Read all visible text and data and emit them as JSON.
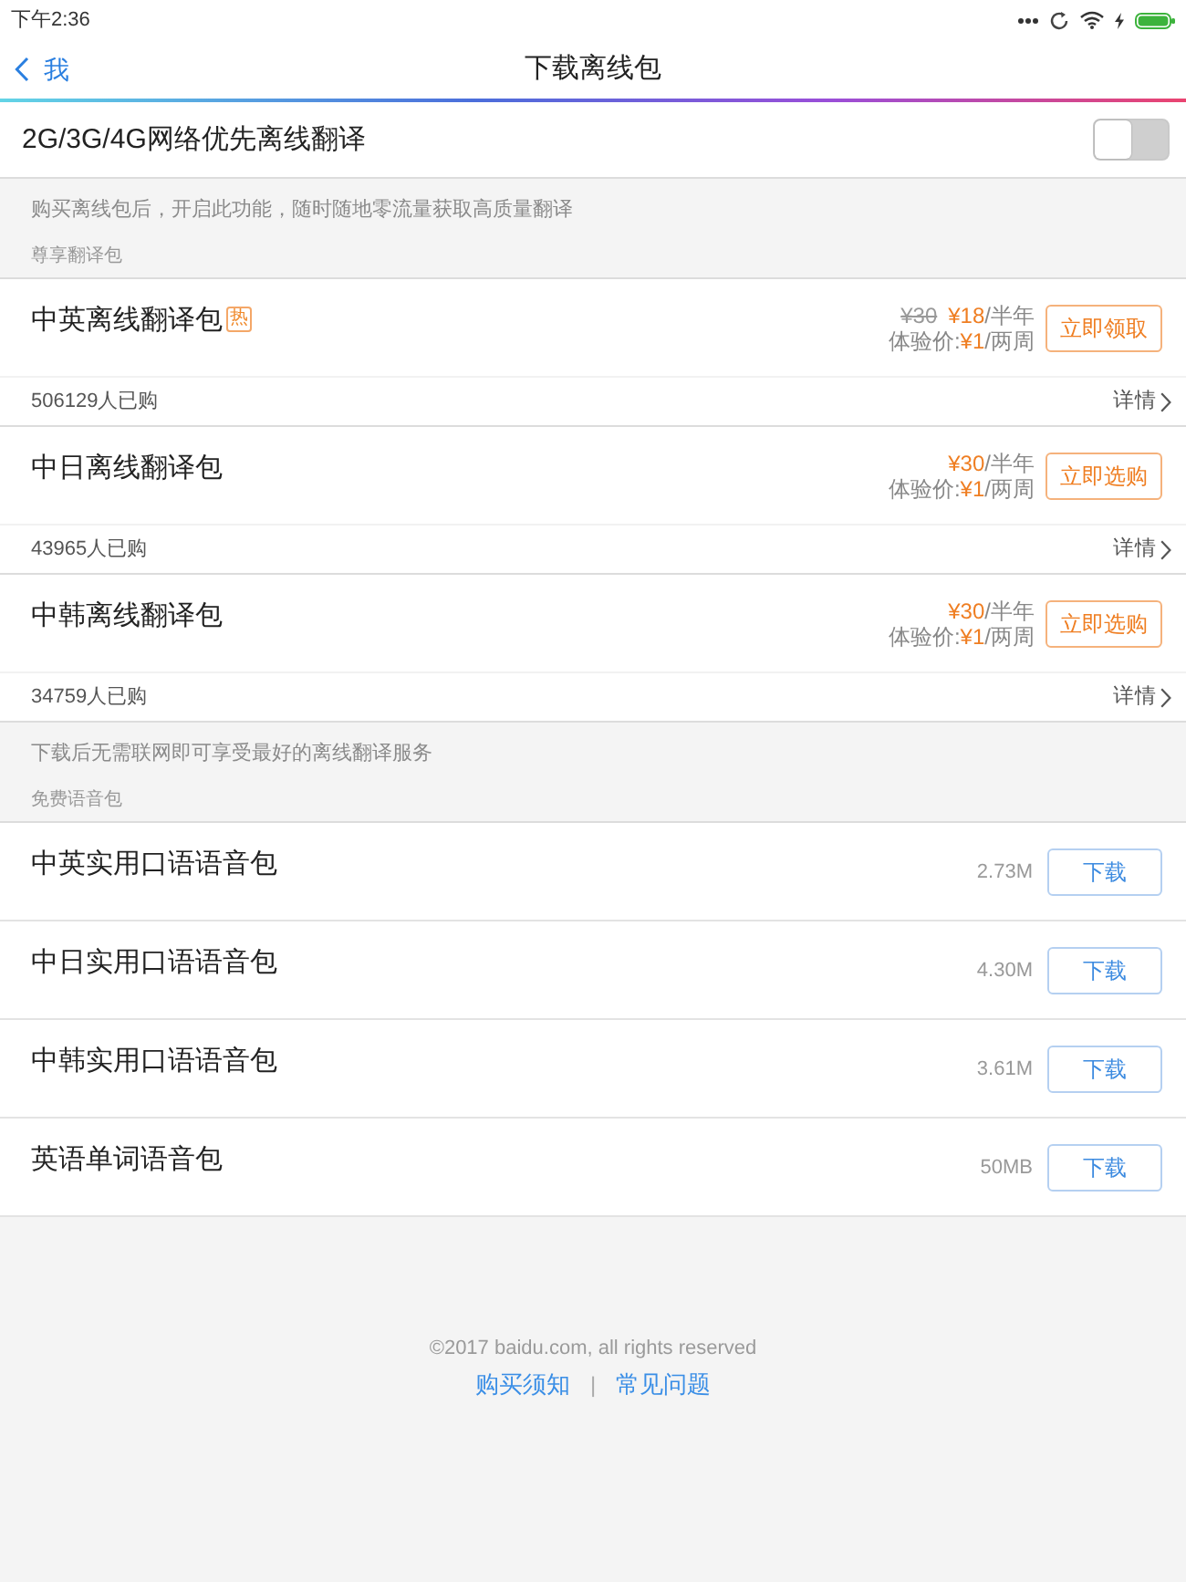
{
  "status_bar": {
    "time": "下午2:36"
  },
  "nav": {
    "back_label": "我",
    "title": "下载离线包"
  },
  "network_setting": {
    "label": "2G/3G/4G网络优先离线翻译",
    "on": false
  },
  "premium_section": {
    "note": "购买离线包后，开启此功能，随时随地零流量获取高质量翻译",
    "heading": "尊享翻译包"
  },
  "packages": [
    {
      "name": "中英离线翻译包",
      "badge": "热",
      "original_price": "¥30",
      "price": "¥18",
      "period": "/半年",
      "trial_label": "体验价:",
      "trial_price": "¥1",
      "trial_period": "/两周",
      "button": "立即领取",
      "buyers": "506129人已购",
      "details": "详情"
    },
    {
      "name": "中日离线翻译包",
      "price": "¥30",
      "period": "/半年",
      "trial_label": "体验价:",
      "trial_price": "¥1",
      "trial_period": "/两周",
      "button": "立即选购",
      "buyers": "43965人已购",
      "details": "详情"
    },
    {
      "name": "中韩离线翻译包",
      "price": "¥30",
      "period": "/半年",
      "trial_label": "体验价:",
      "trial_price": "¥1",
      "trial_period": "/两周",
      "button": "立即选购",
      "buyers": "34759人已购",
      "details": "详情"
    }
  ],
  "free_section": {
    "note": "下载后无需联网即可享受最好的离线翻译服务",
    "heading": "免费语音包"
  },
  "voice_packs": [
    {
      "name": "中英实用口语语音包",
      "size": "2.73M",
      "button": "下载"
    },
    {
      "name": "中日实用口语语音包",
      "size": "4.30M",
      "button": "下载"
    },
    {
      "name": "中韩实用口语语音包",
      "size": "3.61M",
      "button": "下载"
    },
    {
      "name": "英语单词语音包",
      "size": "50MB",
      "button": "下载"
    }
  ],
  "footer": {
    "copyright": "©2017 baidu.com, all rights reserved",
    "links": [
      "购买须知",
      "常见问题"
    ],
    "separator": "|"
  }
}
